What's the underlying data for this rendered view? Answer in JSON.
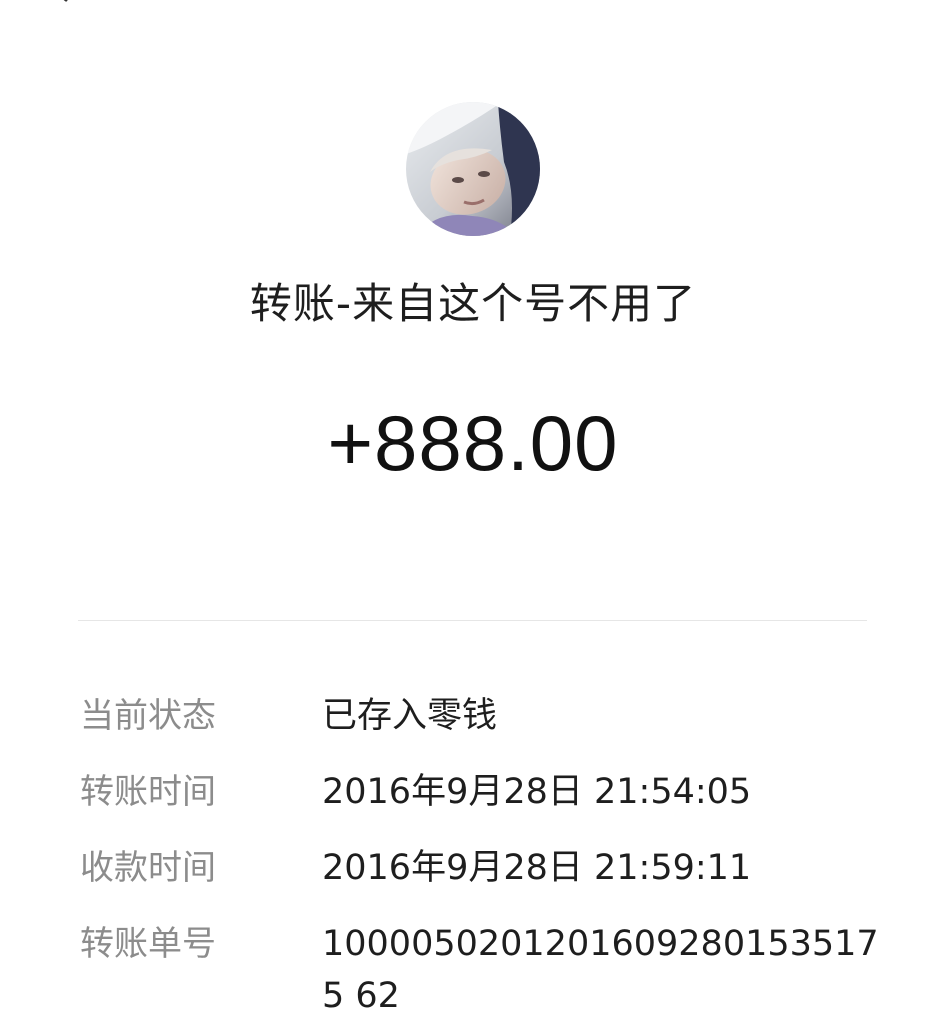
{
  "transfer": {
    "title": "转账-来自这个号不用了",
    "amount": "+888.00"
  },
  "details": {
    "rows": [
      {
        "label": "当前状态",
        "value": "已存入零钱"
      },
      {
        "label": "转账时间",
        "value": "2016年9月28日 21:54:05"
      },
      {
        "label": "收款时间",
        "value": "2016年9月28日 21:59:11"
      },
      {
        "label": "转账单号",
        "value": "10000502012016092801535175 62"
      }
    ]
  }
}
